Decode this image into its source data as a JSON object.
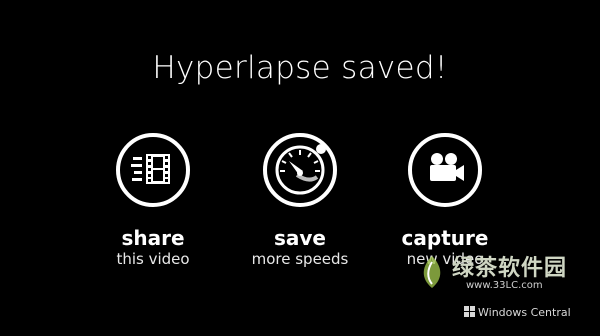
{
  "screen": {
    "title": "Hyperlapse saved!"
  },
  "actions": [
    {
      "icon": "share-video-icon",
      "label": "share",
      "sublabel": "this video"
    },
    {
      "icon": "speedometer-icon",
      "label": "save",
      "sublabel": "more speeds"
    },
    {
      "icon": "video-camera-icon",
      "label": "capture",
      "sublabel": "new video"
    }
  ],
  "watermark": {
    "site_name": "绿茶软件园",
    "url": "www.33LC.com",
    "source": "Windows Central"
  },
  "colors": {
    "background": "#000000",
    "foreground": "#ffffff"
  }
}
